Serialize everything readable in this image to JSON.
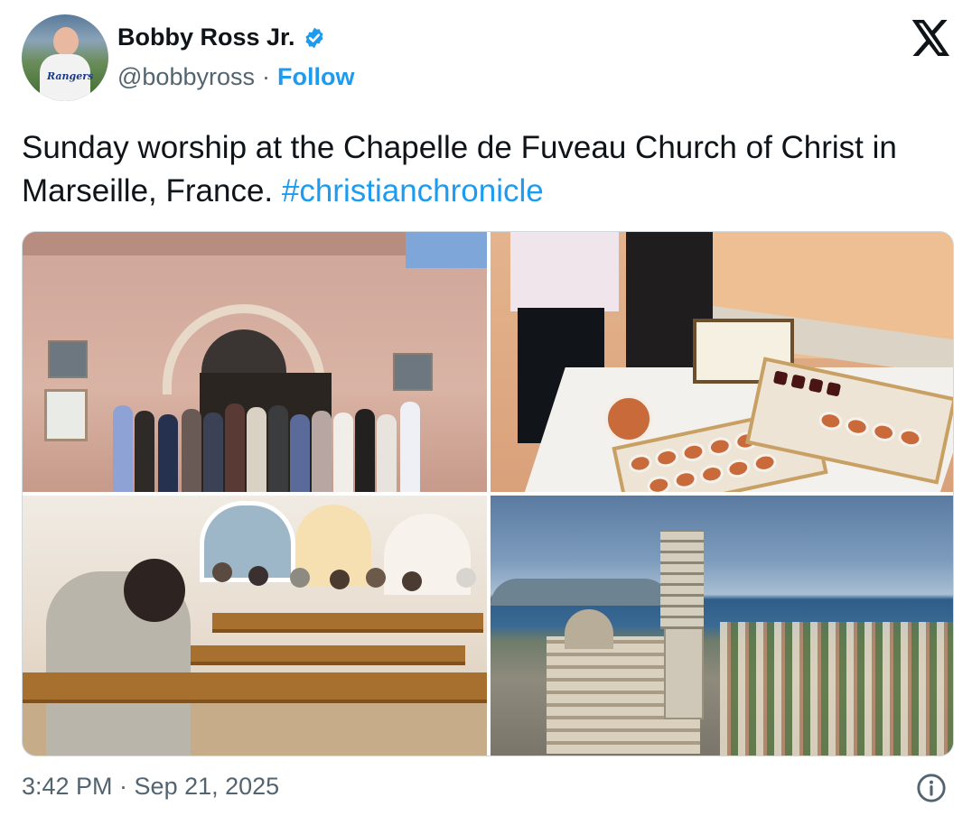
{
  "author": {
    "name": "Bobby Ross Jr.",
    "handle": "@bobbyross",
    "separator": "·",
    "follow_label": "Follow",
    "avatar_logo_text": "Rangers",
    "verified_icon": "verified-badge-icon"
  },
  "tweet": {
    "text": "Sunday worship at the Chapelle de Fuveau Church of Christ in  Marseille, France.",
    "hashtag": "#christianchronicle"
  },
  "media": [
    {
      "name": "church-exterior-photo"
    },
    {
      "name": "communion-table-photo"
    },
    {
      "name": "worship-interior-photo"
    },
    {
      "name": "marseille-basilica-photo"
    }
  ],
  "footer": {
    "timestamp": "3:42 PM · Sep 21, 2025",
    "info_icon": "info-icon"
  },
  "colors": {
    "accent": "#1d9bf0",
    "text": "#0f1419",
    "secondary_text": "#536471",
    "border": "#cfd9de"
  }
}
